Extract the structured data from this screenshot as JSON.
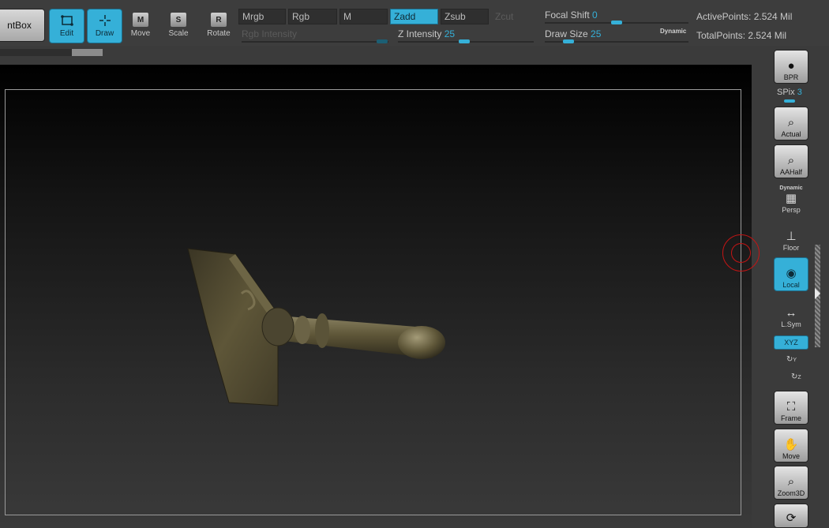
{
  "toolbar": {
    "lightbox_label": "ntBox",
    "edit_label": "Edit",
    "draw_label": "Draw",
    "move_label": "Move",
    "move_key": "M",
    "scale_label": "Scale",
    "scale_key": "S",
    "rotate_label": "Rotate",
    "rotate_key": "R",
    "mrgb_label": "Mrgb",
    "rgb_label": "Rgb",
    "m_label": "M",
    "zadd_label": "Zadd",
    "zsub_label": "Zsub",
    "zcut_label": "Zcut",
    "rgb_intensity_label": "Rgb Intensity",
    "z_intensity_label": "Z Intensity",
    "z_intensity_value": "25",
    "focal_shift_label": "Focal Shift",
    "focal_shift_value": "0",
    "draw_size_label": "Draw Size",
    "draw_size_value": "25",
    "dynamic_label": "Dynamic",
    "active_points": "ActivePoints: 2.524 Mil",
    "total_points": "TotalPoints: 2.524 Mil"
  },
  "shelf": {
    "bpr_label": "BPR",
    "spix_label": "SPix",
    "spix_value": "3",
    "actual_label": "Actual",
    "aahalf_label": "AAHalf",
    "persp_dynamic_label": "Dynamic",
    "persp_label": "Persp",
    "floor_label": "Floor",
    "local_label": "Local",
    "lsym_label": "L.Sym",
    "xyz_label": "XYZ",
    "y_label": "Y",
    "z_label": "Z",
    "frame_label": "Frame",
    "move_label": "Move",
    "zoom3d_label": "Zoom3D"
  },
  "colors": {
    "accent": "#35b0d8",
    "background": "#3b3b3b",
    "gizmo": "#c41414",
    "model": "#5e5638"
  },
  "icons": [
    "edit-icon",
    "draw-icon",
    "move-icon",
    "scale-icon",
    "rotate-icon",
    "bpr-icon",
    "actual-icon",
    "aahalf-icon",
    "persp-icon",
    "floor-icon",
    "local-icon",
    "lsym-icon",
    "rotate-y-icon",
    "rotate-z-icon",
    "frame-icon",
    "hand-icon",
    "zoom3d-icon"
  ]
}
